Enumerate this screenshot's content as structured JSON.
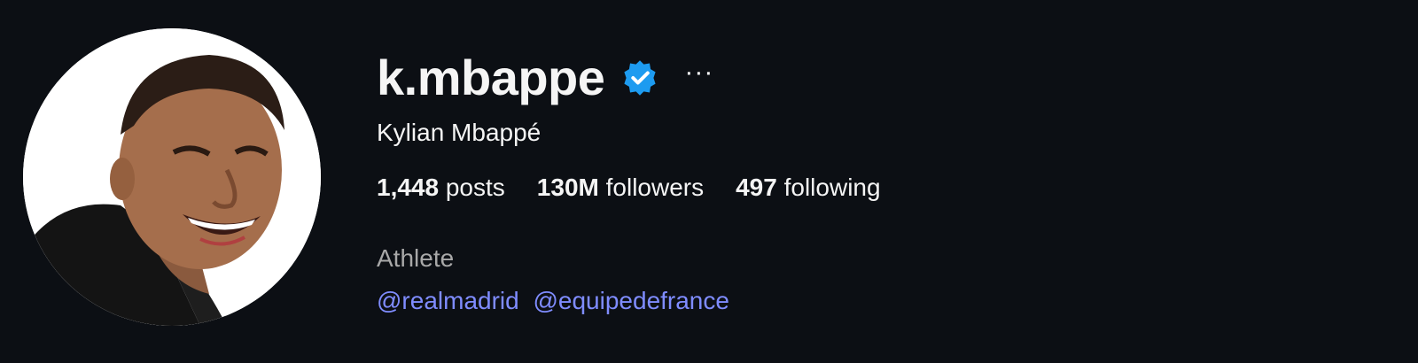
{
  "profile": {
    "username": "k.mbappe",
    "verified_icon": "verified-badge-icon",
    "verified_color": "#1d9bf0",
    "more_label": "···",
    "full_name": "Kylian Mbappé",
    "stats": [
      {
        "count": "1,448",
        "label": "posts"
      },
      {
        "count": "130M",
        "label": "followers"
      },
      {
        "count": "497",
        "label": "following"
      }
    ],
    "category": "Athlete",
    "links": [
      "@realmadrid",
      "@equipedefrance"
    ]
  },
  "colors": {
    "background": "#0c0f14",
    "text": "#f5f5f5",
    "muted": "#a8a8a8",
    "link": "#7f8cff"
  }
}
